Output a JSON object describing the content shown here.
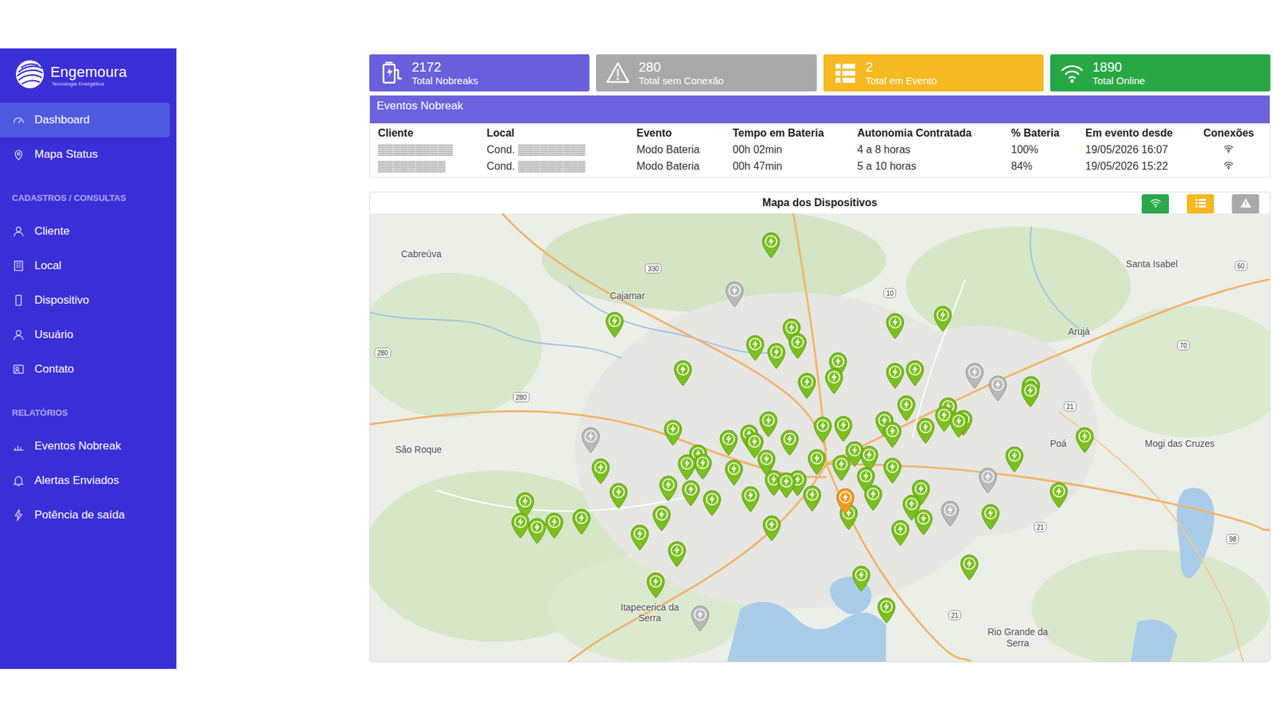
{
  "logo": {
    "name": "Engemoura",
    "tagline": "Tecnologia Energética"
  },
  "sidebar": {
    "groups": [
      {
        "items": [
          {
            "label": "Dashboard",
            "selected": true
          },
          {
            "label": "Mapa Status",
            "selected": false
          }
        ]
      },
      {
        "title": "CADASTROS / CONSULTAS",
        "items": [
          {
            "label": "Cliente",
            "selected": false
          },
          {
            "label": "Local",
            "selected": false
          },
          {
            "label": "Dispositivo",
            "selected": false
          },
          {
            "label": "Usuário",
            "selected": false
          },
          {
            "label": "Contato",
            "selected": false
          }
        ]
      },
      {
        "title": "RELATÓRIOS",
        "items": [
          {
            "label": "Eventos Nobreak",
            "selected": false
          },
          {
            "label": "Alertas Enviados",
            "selected": false
          },
          {
            "label": "Potência de saída",
            "selected": false
          }
        ]
      }
    ]
  },
  "cards": [
    {
      "value": "2172",
      "label": "Total Nobreaks",
      "color": "#6a5fdb"
    },
    {
      "value": "280",
      "label": "Total sem Conexão",
      "color": "#a9a9a9"
    },
    {
      "value": "2",
      "label": "Total em Evento",
      "color": "#f5b921"
    },
    {
      "value": "1890",
      "label": "Total Online",
      "color": "#28a745"
    }
  ],
  "events": {
    "title": "Eventos Nobreak",
    "columns": [
      "Cliente",
      "Local",
      "Evento",
      "Tempo em Bateria",
      "Autonomia Contratada",
      "% Bateria",
      "Em evento desde",
      "Conexões"
    ],
    "rows": [
      {
        "cells": [
          "▒▒▒▒▒▒▒▒▒▒",
          "Cond. ▒▒▒▒▒▒▒▒▒",
          "Modo Bateria",
          "00h 02min",
          "4 a 8 horas",
          "100%",
          "19/05/2026 16:07"
        ],
        "online": true
      },
      {
        "cells": [
          "▒▒▒▒▒▒▒▒▒",
          "Cond. ▒▒▒▒▒▒▒▒▒",
          "Modo Bateria",
          "00h 47min",
          "5 a 10 horas",
          "84%",
          "19/05/2026 15:22"
        ],
        "online": true
      }
    ]
  },
  "map": {
    "title": "Mapa dos Dispositivos",
    "filters": [
      {
        "color": "#2aa84a"
      },
      {
        "color": "#f5b921"
      },
      {
        "color": "#a9a9a9"
      }
    ],
    "places": [
      "Cabreúva",
      "Cajamar",
      "Santa Isabel",
      "Arujá",
      "São Roque",
      "Poá",
      "Mogi das Cruzes",
      "Itapecerica da Serra",
      "Rio Grande da Serra"
    ],
    "roads": [
      "330",
      "10",
      "280",
      "280",
      "60",
      "70",
      "21",
      "21",
      "98",
      "21"
    ],
    "pins": [
      {
        "status": "offline"
      },
      {
        "status": "offline"
      },
      {
        "status": "offline"
      },
      {
        "status": "offline"
      },
      {
        "status": "offline"
      },
      {
        "status": "offline"
      },
      {
        "status": "offline"
      },
      {
        "status": "event"
      },
      {
        "status": "online"
      },
      {
        "status": "online"
      },
      {
        "status": "online"
      },
      {
        "status": "online"
      },
      {
        "status": "online"
      },
      {
        "status": "online"
      },
      {
        "status": "online"
      },
      {
        "status": "online"
      },
      {
        "status": "online"
      },
      {
        "status": "online"
      },
      {
        "status": "online"
      },
      {
        "status": "online"
      },
      {
        "status": "online"
      },
      {
        "status": "online"
      },
      {
        "status": "online"
      },
      {
        "status": "online"
      },
      {
        "status": "online"
      },
      {
        "status": "online"
      },
      {
        "status": "online"
      },
      {
        "status": "online"
      },
      {
        "status": "online"
      },
      {
        "status": "online"
      },
      {
        "status": "online"
      },
      {
        "status": "online"
      },
      {
        "status": "online"
      },
      {
        "status": "online"
      },
      {
        "status": "online"
      },
      {
        "status": "online"
      },
      {
        "status": "online"
      },
      {
        "status": "online"
      },
      {
        "status": "online"
      },
      {
        "status": "online"
      },
      {
        "status": "online"
      },
      {
        "status": "online"
      },
      {
        "status": "online"
      },
      {
        "status": "online"
      },
      {
        "status": "online"
      },
      {
        "status": "online"
      },
      {
        "status": "online"
      },
      {
        "status": "online"
      },
      {
        "status": "online"
      },
      {
        "status": "online"
      },
      {
        "status": "online"
      },
      {
        "status": "online"
      },
      {
        "status": "online"
      },
      {
        "status": "online"
      },
      {
        "status": "online"
      },
      {
        "status": "online"
      },
      {
        "status": "online"
      },
      {
        "status": "online"
      },
      {
        "status": "online"
      },
      {
        "status": "online"
      },
      {
        "status": "online"
      },
      {
        "status": "online"
      },
      {
        "status": "online"
      },
      {
        "status": "online"
      },
      {
        "status": "online"
      },
      {
        "status": "online"
      },
      {
        "status": "online"
      },
      {
        "status": "online"
      },
      {
        "status": "online"
      },
      {
        "status": "online"
      },
      {
        "status": "online"
      },
      {
        "status": "online"
      },
      {
        "status": "online"
      },
      {
        "status": "online"
      },
      {
        "status": "online"
      },
      {
        "status": "online"
      },
      {
        "status": "online"
      },
      {
        "status": "online"
      },
      {
        "status": "online"
      },
      {
        "status": "online"
      },
      {
        "status": "online"
      },
      {
        "status": "online"
      },
      {
        "status": "online"
      },
      {
        "status": "online"
      }
    ]
  }
}
